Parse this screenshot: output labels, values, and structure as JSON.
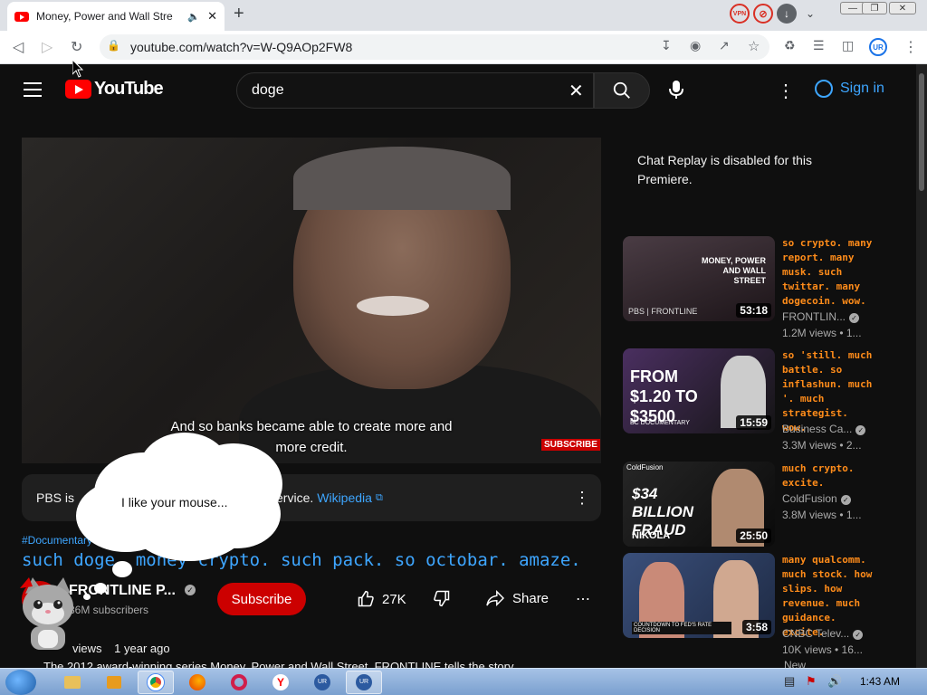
{
  "browser": {
    "tab_title": "Money, Power and Wall Stre",
    "url": "youtube.com/watch?v=W-Q9AOp2FW8",
    "ext_vpn_label": "VPN",
    "profile_initials": "UR"
  },
  "youtube": {
    "logo_text": "YouTube",
    "search_value": "doge",
    "sign_in_label": "Sign in"
  },
  "video": {
    "caption_line1": "And so banks became able to create more and",
    "caption_line2": "more credit.",
    "subscribe_badge": "SUBSCRIBE",
    "info_text": "PBS is ",
    "info_text_tail": " service.",
    "info_link": "Wikipedia",
    "hashtag": "#Documentary",
    "title": "such doge. money crypto. such pack. so octobar. amaze.",
    "channel_name": "FRONTLINE P...",
    "subscribers": "86M subscribers",
    "subscribe_label": "Subscribe",
    "likes": "27K",
    "share_label": "Share",
    "views_line": "views",
    "age": "1 year ago",
    "description": "The 2012 award-winning series Money, Power and Wall Street, FRONTLINE tells the story"
  },
  "chat_replay": "Chat Replay is disabled for this Premiere.",
  "recommendations": [
    {
      "title": "so crypto. many report. many musk. such twittar. many dogecoin. wow.",
      "channel": "FRONTLIN...",
      "meta": "1.2M views • 1...",
      "duration": "53:18",
      "thumb_text": "MONEY, POWER AND WALL STREET",
      "thumb_sub": "PBS | FRONTLINE",
      "thumb_colors": [
        "#3a2f35",
        "#1c1418"
      ]
    },
    {
      "title": "so 'still. much battle. so inflashun. much '. much strategist. wow.",
      "channel": "Business Ca...",
      "meta": "3.3M views • 2...",
      "duration": "15:59",
      "thumb_text": "FROM $1.20 TO $3500",
      "thumb_sub": "BC DOCUMENTARY",
      "thumb_colors": [
        "#3b2a4a",
        "#111"
      ]
    },
    {
      "title": "much crypto. excite.",
      "channel": "ColdFusion",
      "meta": "3.8M views • 1...",
      "duration": "25:50",
      "thumb_text": "$34 BILLION FRAUD",
      "thumb_sub": "NIKOLA",
      "thumb_colors": [
        "#222",
        "#0a0a0a"
      ]
    },
    {
      "title": "many qualcomm. much stock. how slips. how revenue. much guidance. excite.",
      "channel": "CNBC Telev...",
      "meta": "10K views • 16...",
      "duration": "3:58",
      "thumb_text": "COUNTDOWN TO FED'S RATE DECISION",
      "thumb_sub": "",
      "thumb_colors": [
        "#3a4f7a",
        "#1e2a44"
      ]
    }
  ],
  "bubble_text": "I like your mouse...",
  "more_label": "New",
  "taskbar": {
    "clock": "1:43 AM"
  }
}
